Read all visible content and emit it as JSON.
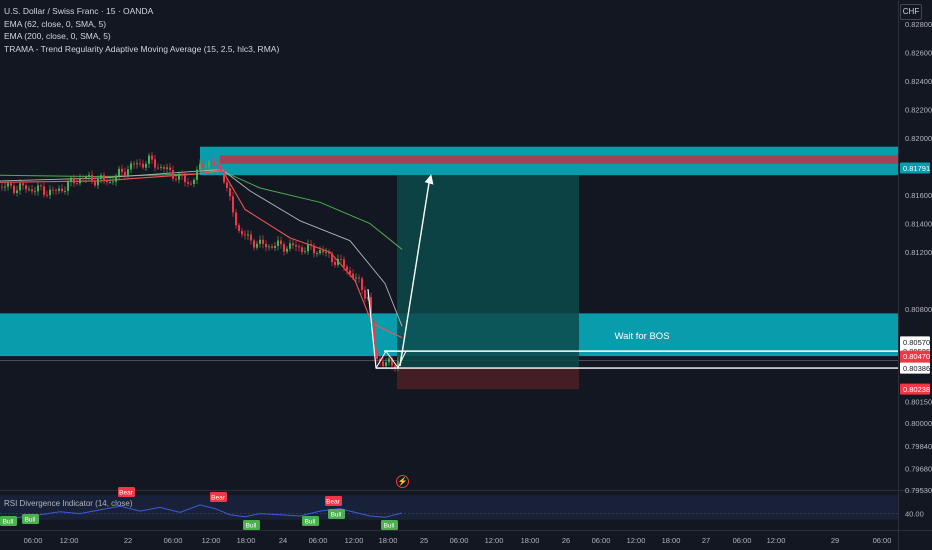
{
  "header": {
    "symbol": "U.S. Dollar / Swiss Franc · 15 · OANDA",
    "indicators": [
      "EMA (62, close, 0, SMA, 5)",
      "EMA (200, close, 0, SMA, 5)",
      "TRAMA - Trend Regularity Adaptive Moving Average (15, 2.5, hlc3, RMA)"
    ],
    "currency": "CHF"
  },
  "annotations": {
    "wait_for_bos": "Wait for BOS"
  },
  "rsi_panel": {
    "title": "RSI Divergence Indicator (14, close)",
    "level_label": "40.00",
    "signals": [
      {
        "type": "Bull",
        "label": "Bull"
      },
      {
        "type": "Bull",
        "label": "Bull"
      },
      {
        "type": "Bear",
        "label": "Bear"
      },
      {
        "type": "Bear",
        "label": "Bear"
      },
      {
        "type": "Bull",
        "label": "Bull"
      },
      {
        "type": "Bull",
        "label": "Bull"
      },
      {
        "type": "Bull",
        "label": "Bull"
      },
      {
        "type": "Bear",
        "label": "Bear"
      },
      {
        "type": "Bull",
        "label": "Bull"
      }
    ]
  },
  "colors": {
    "background": "#131722",
    "bull": "#4caf50",
    "bear": "#f23645",
    "zone_teal": "#089cac",
    "zone_red": "#a04455",
    "tp_zone": "#0d4a4a",
    "sl_zone": "#4a1f24",
    "ema62": "#ef5350",
    "ema200": "#b2b5be",
    "trama": "#4caf50",
    "rsi_line": "#3f5ad8"
  },
  "chart_data": {
    "type": "candlestick",
    "ylim": [
      0.7953,
      0.8297
    ],
    "y_ticks": [
      "0.82800",
      "0.82600",
      "0.82400",
      "0.82200",
      "0.82000",
      "0.81600",
      "0.81400",
      "0.81200",
      "0.80800",
      "0.80150",
      "0.80000",
      "0.79840",
      "0.79680",
      "0.79530"
    ],
    "price_badges": [
      {
        "label": "0.81791",
        "value": 0.81791,
        "kind": "zone"
      },
      {
        "label": "0.80570",
        "value": 0.8057,
        "kind": "level"
      },
      {
        "label": "0.80505",
        "value": 0.80505,
        "kind": "level"
      },
      {
        "label": "0.80470",
        "value": 0.8047,
        "kind": "current"
      },
      {
        "label": "11:51",
        "value": 0.80408,
        "kind": "countdown"
      },
      {
        "label": "0.80386",
        "value": 0.80386,
        "kind": "level"
      },
      {
        "label": "0.80238",
        "value": 0.80238,
        "kind": "stop"
      }
    ],
    "x_ticks": [
      "06:00",
      "12:00",
      "22",
      "06:00",
      "12:00",
      "18:00",
      "24",
      "06:00",
      "12:00",
      "18:00",
      "25",
      "06:00",
      "12:00",
      "18:00",
      "26",
      "06:00",
      "12:00",
      "18:00",
      "27",
      "06:00",
      "12:00",
      "29",
      "06:00"
    ],
    "zones": [
      {
        "name": "supply-zone",
        "y_top": 0.8194,
        "y_bottom": 0.8174
      },
      {
        "name": "supply-zone-core",
        "y_top": 0.8188,
        "y_bottom": 0.8182
      },
      {
        "name": "demand-zone",
        "y_top": 0.8077,
        "y_bottom": 0.8047
      }
    ],
    "levels": {
      "entry": 0.80386,
      "bos": 0.80505,
      "stop": 0.80238,
      "target": 0.8174
    },
    "price_path": [
      [
        0,
        0.8166
      ],
      [
        25,
        0.8165
      ],
      [
        55,
        0.8162
      ],
      [
        80,
        0.8172
      ],
      [
        110,
        0.817
      ],
      [
        130,
        0.818
      ],
      [
        150,
        0.8184
      ],
      [
        175,
        0.8174
      ],
      [
        190,
        0.8168
      ],
      [
        205,
        0.8184
      ],
      [
        222,
        0.8178
      ],
      [
        230,
        0.8155
      ],
      [
        240,
        0.8133
      ],
      [
        260,
        0.8125
      ],
      [
        290,
        0.8124
      ],
      [
        320,
        0.8121
      ],
      [
        345,
        0.811
      ],
      [
        360,
        0.8097
      ],
      [
        368,
        0.8088
      ],
      [
        375,
        0.8045
      ],
      [
        384,
        0.8043
      ],
      [
        392,
        0.804
      ],
      [
        402,
        0.8047
      ]
    ],
    "ema62": [
      [
        0,
        0.8169
      ],
      [
        100,
        0.817
      ],
      [
        200,
        0.8175
      ],
      [
        222,
        0.8178
      ],
      [
        245,
        0.815
      ],
      [
        290,
        0.813
      ],
      [
        330,
        0.812
      ],
      [
        355,
        0.81
      ],
      [
        372,
        0.807
      ],
      [
        402,
        0.806
      ]
    ],
    "ema200": [
      [
        0,
        0.817
      ],
      [
        100,
        0.8172
      ],
      [
        200,
        0.8177
      ],
      [
        222,
        0.8178
      ],
      [
        250,
        0.8163
      ],
      [
        300,
        0.8142
      ],
      [
        350,
        0.8128
      ],
      [
        385,
        0.8098
      ],
      [
        402,
        0.8068
      ]
    ],
    "trama": [
      [
        0,
        0.8174
      ],
      [
        100,
        0.8173
      ],
      [
        200,
        0.8175
      ],
      [
        222,
        0.8177
      ],
      [
        260,
        0.8165
      ],
      [
        320,
        0.8155
      ],
      [
        370,
        0.814
      ],
      [
        402,
        0.8122
      ]
    ],
    "rsi": [
      [
        0,
        32
      ],
      [
        20,
        34
      ],
      [
        40,
        38
      ],
      [
        60,
        43
      ],
      [
        80,
        40
      ],
      [
        100,
        46
      ],
      [
        120,
        52
      ],
      [
        140,
        44
      ],
      [
        160,
        50
      ],
      [
        180,
        42
      ],
      [
        200,
        54
      ],
      [
        215,
        48
      ],
      [
        230,
        38
      ],
      [
        245,
        35
      ],
      [
        260,
        40
      ],
      [
        280,
        38
      ],
      [
        300,
        36
      ],
      [
        320,
        44
      ],
      [
        340,
        48
      ],
      [
        355,
        42
      ],
      [
        370,
        36
      ],
      [
        385,
        34
      ],
      [
        402,
        41
      ]
    ]
  }
}
